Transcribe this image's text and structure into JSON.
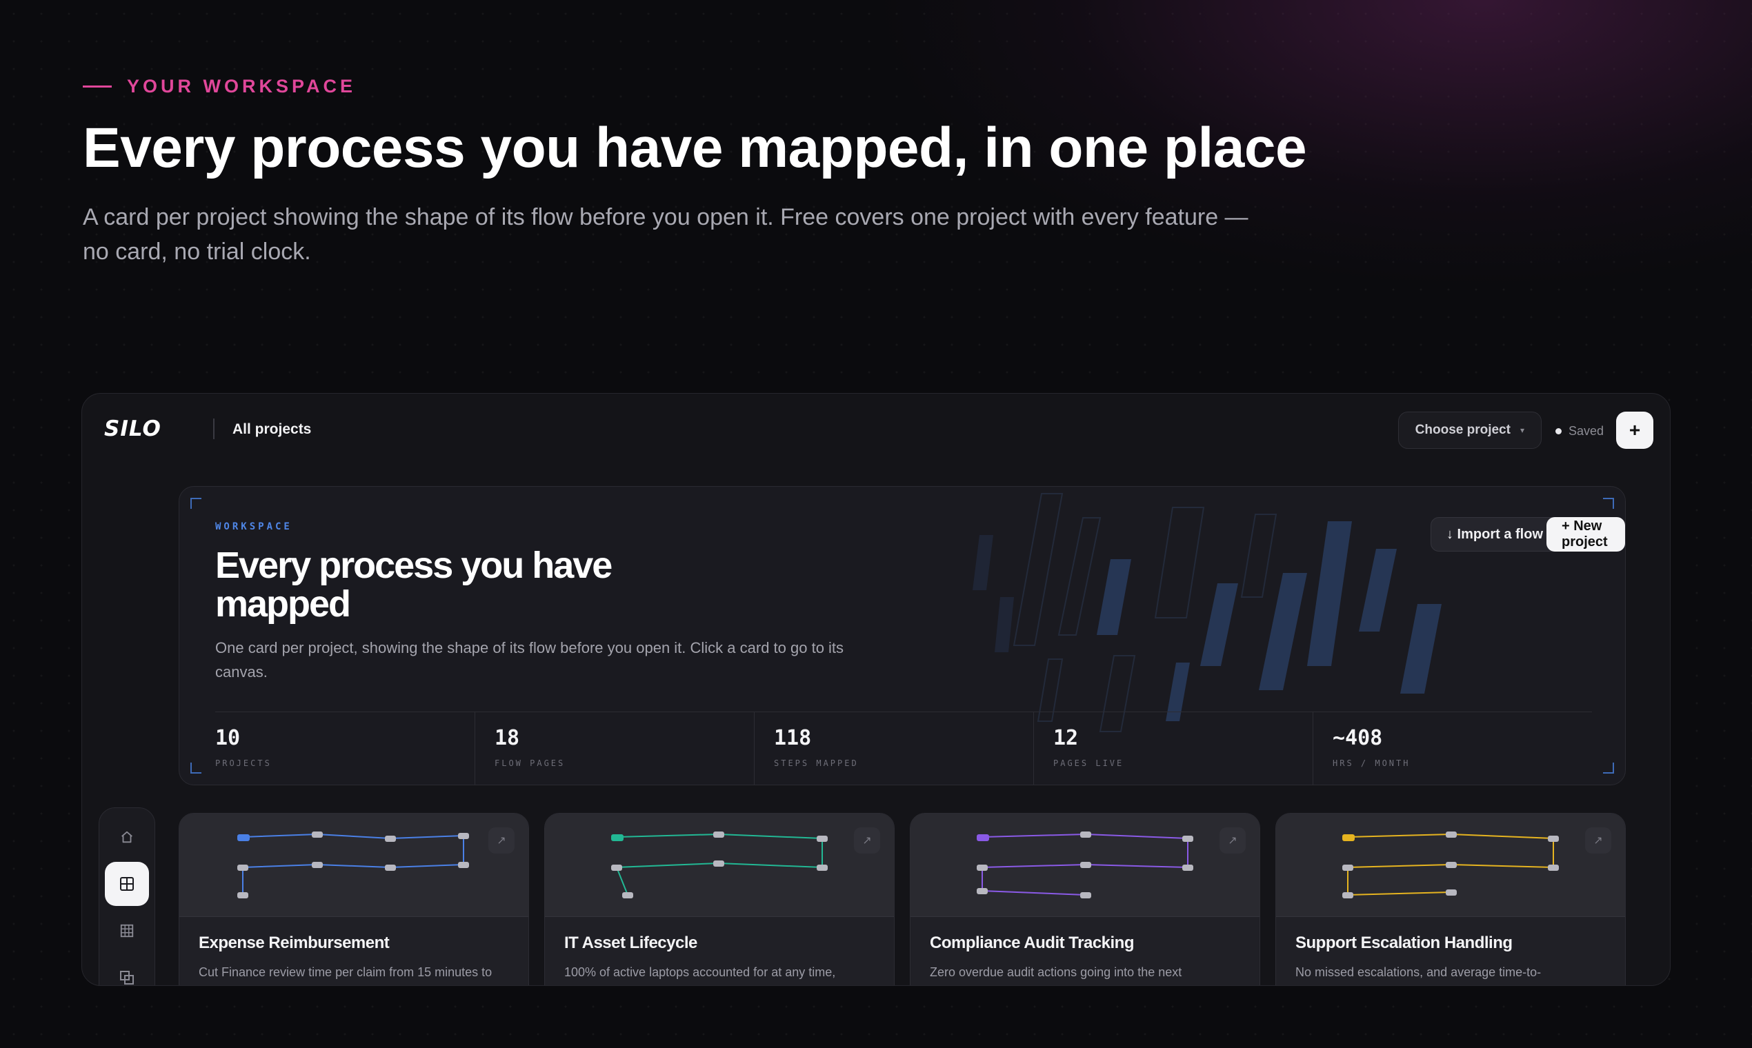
{
  "hero": {
    "eyebrow": "YOUR WORKSPACE",
    "title": "Every process you have mapped, in one place",
    "subtitle": "A card per project showing the shape of its flow before you open it. Free covers one project with every feature — no card, no trial clock."
  },
  "topbar": {
    "logo": "SILO",
    "section": "All projects",
    "project_select": "Choose project",
    "status": "Saved",
    "add_label": "+"
  },
  "workspace": {
    "label": "WORKSPACE",
    "title": "Every process you have mapped",
    "description": "One card per project, showing the shape of its flow before you open it. Click a card to go to its canvas.",
    "import_label": "↓ Import a flow",
    "new_label": "+ New project",
    "stats": [
      {
        "value": "10",
        "label": "PROJECTS"
      },
      {
        "value": "18",
        "label": "FLOW PAGES"
      },
      {
        "value": "118",
        "label": "STEPS MAPPED"
      },
      {
        "value": "12",
        "label": "PAGES LIVE"
      },
      {
        "value": "~408",
        "label": "HRS / MONTH"
      }
    ]
  },
  "rail": {
    "icons": [
      "home-icon",
      "grid-icon",
      "table-icon",
      "layers-icon"
    ]
  },
  "colors": {
    "accent_pink": "#e0479a",
    "workspace_blue": "#4f86e6",
    "card_blue": "#4a80e6",
    "card_teal": "#22b894",
    "card_purple": "#8a5ae6",
    "card_amber": "#e6b420"
  },
  "cards": [
    {
      "title": "Expense Reimbursement",
      "description": "Cut Finance review time per claim from 15 minutes to"
    },
    {
      "title": "IT Asset Lifecycle",
      "description": "100% of active laptops accounted for at any time,"
    },
    {
      "title": "Compliance Audit Tracking",
      "description": "Zero overdue audit actions going into the next"
    },
    {
      "title": "Support Escalation Handling",
      "description": "No missed escalations, and average time-to-"
    }
  ]
}
